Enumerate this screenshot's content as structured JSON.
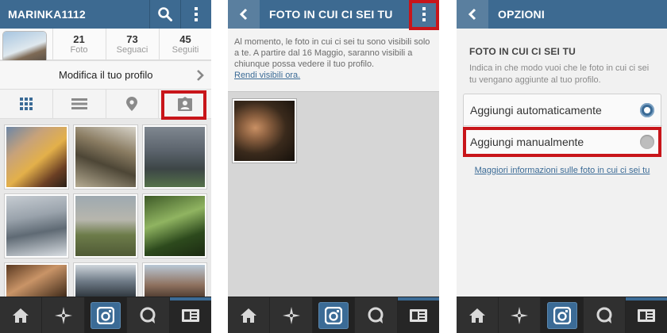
{
  "panel1": {
    "username": "MARINKA1112",
    "stats": [
      {
        "value": "21",
        "label": "Foto"
      },
      {
        "value": "73",
        "label": "Seguaci"
      },
      {
        "value": "45",
        "label": "Seguiti"
      }
    ],
    "edit_profile_label": "Modifica il tuo profilo"
  },
  "panel2": {
    "title": "FOTO IN CUI CI SEI TU",
    "notice_text": "Al momento, le foto in cui ci sei tu sono visibili solo a te. A partire dal 16 Maggio, saranno visibili a chiunque possa vedere il tuo profilo.",
    "notice_link": "Rendi visibili ora."
  },
  "panel3": {
    "title": "OPZIONI",
    "section_title": "FOTO IN CUI CI SEI TU",
    "section_desc": "Indica in che modo vuoi che le foto in cui ci sei tu vengano aggiunte al tuo profilo.",
    "options": [
      {
        "label": "Aggiungi automaticamente",
        "selected": true
      },
      {
        "label": "Aggiungi manualmente",
        "selected": false
      }
    ],
    "more_info_link": "Maggiori informazioni sulle foto in cui ci sei tu"
  },
  "bottom_nav_icons": [
    "home-icon",
    "explore-star-icon",
    "camera-icon",
    "chat-bubble-icon",
    "news-icon"
  ],
  "colors": {
    "topbar": "#3d6a91",
    "highlight": "#c8151a",
    "link": "#3b6b96",
    "bottom_nav": "#303030"
  }
}
